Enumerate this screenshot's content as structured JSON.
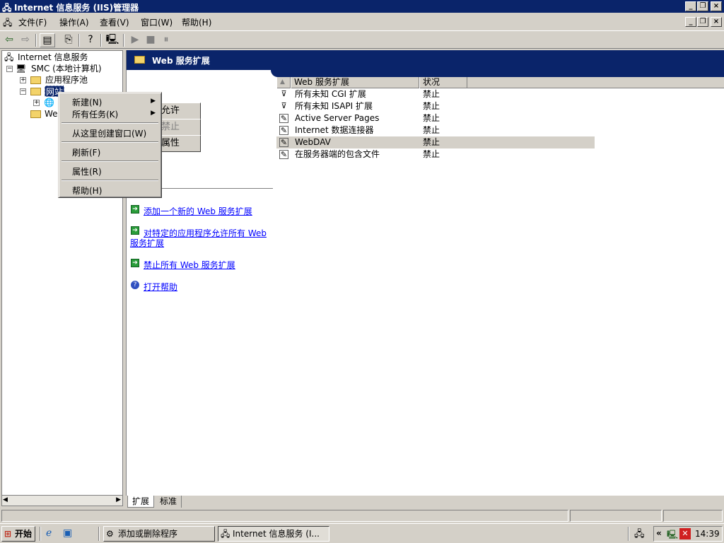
{
  "window": {
    "title": "Internet 信息服务 (IIS)管理器"
  },
  "menu": [
    "文件(F)",
    "操作(A)",
    "查看(V)",
    "窗口(W)",
    "帮助(H)"
  ],
  "tree": {
    "root": "Internet 信息服务",
    "computer": "SMC (本地计算机)",
    "app_pools": "应用程序池",
    "websites": "网站",
    "web_ext": "Web"
  },
  "context_menu": {
    "new": "新建(N)",
    "all_tasks": "所有任务(K)",
    "new_window": "从这里创建窗口(W)",
    "refresh": "刷新(F)",
    "properties": "属性(R)",
    "help": "帮助(H)"
  },
  "right_header": "Web 服务扩展",
  "actions": {
    "allow": "允许",
    "prohibit": "禁止",
    "properties": "属性"
  },
  "tasks": {
    "add_new": "添加一个新的 Web 服务扩展",
    "allow_app_line1": "对特定的应用程序允许所有 Web",
    "allow_app_line2": "服务扩展",
    "prohibit_all": "禁止所有 Web 服务扩展",
    "open_help": "打开帮助"
  },
  "list": {
    "columns": [
      "Web 服务扩展",
      "状况"
    ],
    "rows": [
      {
        "name": "所有未知 CGI 扩展",
        "status": "禁止",
        "icon": "filter-icon"
      },
      {
        "name": "所有未知 ISAPI 扩展",
        "status": "禁止",
        "icon": "filter-icon"
      },
      {
        "name": "Active Server Pages",
        "status": "禁止",
        "icon": "extension-icon"
      },
      {
        "name": "Internet 数据连接器",
        "status": "禁止",
        "icon": "extension-icon"
      },
      {
        "name": "WebDAV",
        "status": "禁止",
        "icon": "extension-icon"
      },
      {
        "name": "在服务器端的包含文件",
        "status": "禁止",
        "icon": "extension-icon"
      }
    ]
  },
  "tabs": [
    "扩展",
    "标准"
  ],
  "taskbar": {
    "start": "开始",
    "items": [
      "添加或删除程序",
      "Internet 信息服务 (I..."
    ],
    "clock": "14:39"
  },
  "colors": {
    "title_bar": "#0a246a",
    "face": "#d4d0c8",
    "link": "#0000ff"
  }
}
